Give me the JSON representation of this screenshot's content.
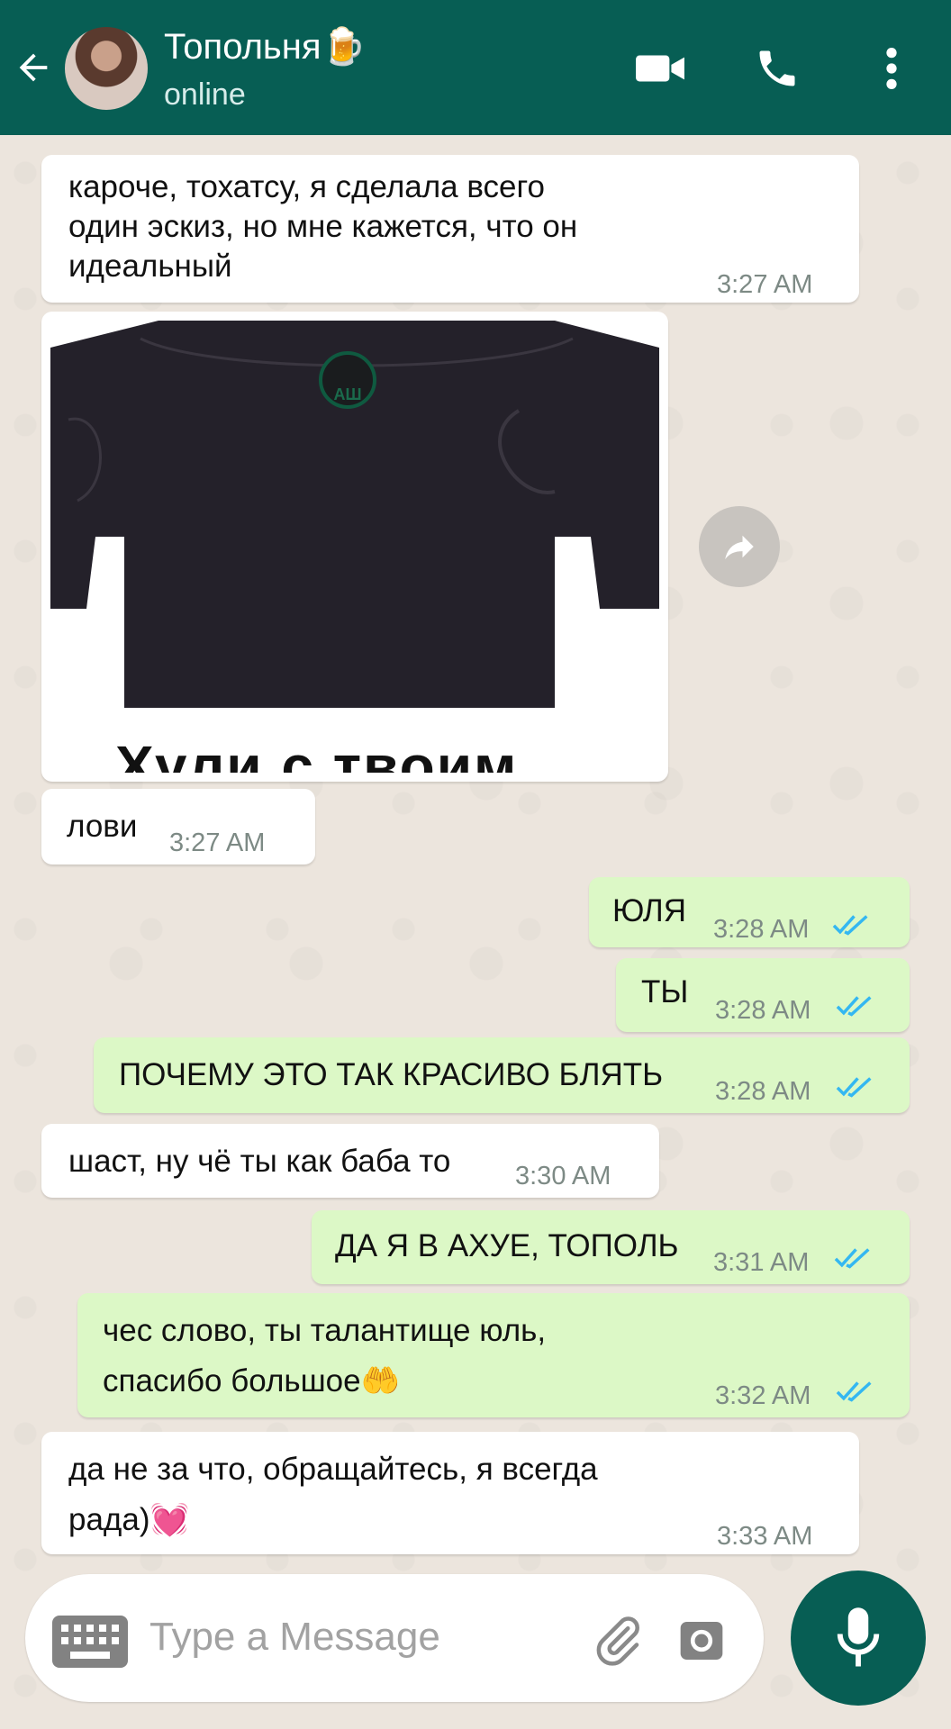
{
  "header": {
    "contact_name": "Топольня🍺",
    "status": "online",
    "icons": [
      "back-arrow-icon",
      "video-call-icon",
      "voice-call-icon",
      "more-vert-icon"
    ],
    "color": "#075e54"
  },
  "messages": [
    {
      "direction": "incoming",
      "text": "кароче, тохатсу, я сделала всего\nодин эскиз, но мне кажется, что он\nидеальный",
      "time": "3:27 AM"
    },
    {
      "direction": "incoming",
      "type": "image",
      "caption_text": "Хули с твоим",
      "patch_text": "АШ"
    },
    {
      "direction": "incoming",
      "text": "лови",
      "time": "3:27 AM"
    },
    {
      "direction": "outgoing",
      "text": "ЮЛЯ",
      "time": "3:28 AM",
      "read": true
    },
    {
      "direction": "outgoing",
      "text": "ТЫ",
      "time": "3:28 AM",
      "read": true
    },
    {
      "direction": "outgoing",
      "text": "ПОЧЕМУ ЭТО ТАК КРАСИВО БЛЯТЬ",
      "time": "3:28 AM",
      "read": true
    },
    {
      "direction": "incoming",
      "text": "шаст, ну чё ты как баба то",
      "time": "3:30 AM"
    },
    {
      "direction": "outgoing",
      "text": "ДА Я В АХУЕ, ТОПОЛЬ",
      "time": "3:31 AM",
      "read": true
    },
    {
      "direction": "outgoing",
      "text": "чес слово, ты талантище юль,\nспасибо большое🤲",
      "time": "3:32 AM",
      "read": true
    },
    {
      "direction": "incoming",
      "text": "да не за что, обращайтесь, я всегда\nрада)💓",
      "time": "3:33 AM"
    }
  ],
  "input": {
    "placeholder": "Type a Message",
    "value": ""
  },
  "colors": {
    "incoming_bubble": "#ffffff",
    "outgoing_bubble": "#dcf8c6",
    "read_ticks": "#34b7f1",
    "mic_button": "#075e54"
  }
}
